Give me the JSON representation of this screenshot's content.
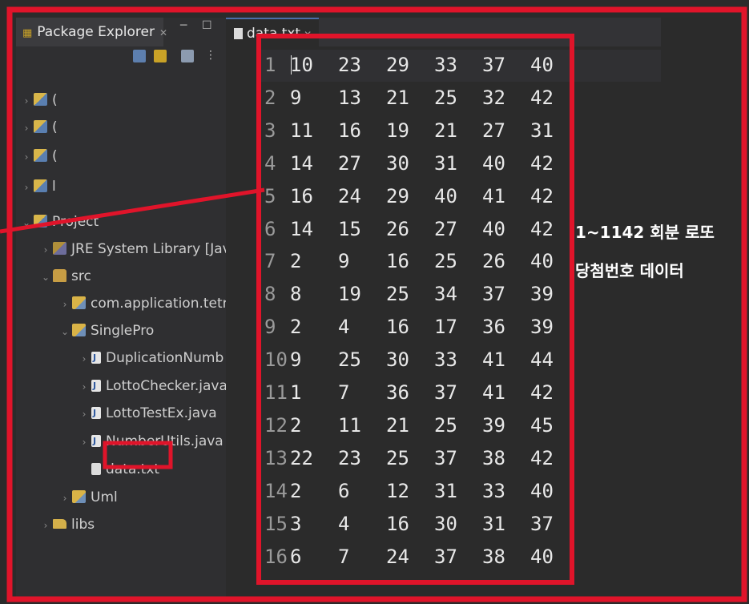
{
  "explorer": {
    "title": "Package Explorer",
    "tab_close": "✕",
    "minimize_glyph": "─",
    "maximize_glyph": "☐",
    "tree": [
      {
        "label": "(",
        "icon": "project-icon",
        "depth": 0,
        "arrow": "›"
      },
      {
        "label": "(",
        "icon": "project-icon",
        "depth": 0,
        "arrow": "›"
      },
      {
        "label": "(",
        "icon": "project-icon",
        "depth": 0,
        "arrow": "›"
      },
      {
        "label": "l",
        "icon": "project-icon",
        "depth": 0,
        "arrow": "›"
      },
      {
        "label": "Project",
        "icon": "project-icon",
        "depth": 0,
        "arrow": "⌄"
      },
      {
        "label": "JRE System Library [Java",
        "icon": "library-icon",
        "depth": 1,
        "arrow": "›"
      },
      {
        "label": "src",
        "icon": "source-folder-icon",
        "depth": 1,
        "arrow": "⌄"
      },
      {
        "label": "com.application.tetri",
        "icon": "package-icon",
        "depth": 2,
        "arrow": "›"
      },
      {
        "label": "SinglePro",
        "icon": "package-icon",
        "depth": 2,
        "arrow": "⌄"
      },
      {
        "label": "DuplicationNumb",
        "icon": "java-file-icon",
        "depth": 3,
        "arrow": "›"
      },
      {
        "label": "LottoChecker.java",
        "icon": "java-file-icon",
        "depth": 3,
        "arrow": "›"
      },
      {
        "label": "LottoTestEx.java",
        "icon": "java-file-icon",
        "depth": 3,
        "arrow": "›"
      },
      {
        "label": "NumberUtils.java",
        "icon": "java-file-icon",
        "depth": 3,
        "arrow": "›"
      },
      {
        "label": "data.txt",
        "icon": "text-file-icon",
        "depth": 3,
        "arrow": ""
      },
      {
        "label": "Uml",
        "icon": "package-icon",
        "depth": 2,
        "arrow": "›"
      },
      {
        "label": "libs",
        "icon": "folder-icon",
        "depth": 1,
        "arrow": "›"
      }
    ]
  },
  "editor": {
    "tab_label": "data.txt",
    "tab_close": "✕",
    "lines": [
      {
        "n": "1",
        "values": [
          "10",
          "23",
          "29",
          "33",
          "37",
          "40"
        ]
      },
      {
        "n": "2",
        "values": [
          "9",
          "13",
          "21",
          "25",
          "32",
          "42"
        ]
      },
      {
        "n": "3",
        "values": [
          "11",
          "16",
          "19",
          "21",
          "27",
          "31"
        ]
      },
      {
        "n": "4",
        "values": [
          "14",
          "27",
          "30",
          "31",
          "40",
          "42"
        ]
      },
      {
        "n": "5",
        "values": [
          "16",
          "24",
          "29",
          "40",
          "41",
          "42"
        ]
      },
      {
        "n": "6",
        "values": [
          "14",
          "15",
          "26",
          "27",
          "40",
          "42"
        ]
      },
      {
        "n": "7",
        "values": [
          "2",
          "9",
          "16",
          "25",
          "26",
          "40"
        ]
      },
      {
        "n": "8",
        "values": [
          "8",
          "19",
          "25",
          "34",
          "37",
          "39"
        ]
      },
      {
        "n": "9",
        "values": [
          "2",
          "4",
          "16",
          "17",
          "36",
          "39"
        ]
      },
      {
        "n": "10",
        "values": [
          "9",
          "25",
          "30",
          "33",
          "41",
          "44"
        ]
      },
      {
        "n": "11",
        "values": [
          "1",
          "7",
          "36",
          "37",
          "41",
          "42"
        ]
      },
      {
        "n": "12",
        "values": [
          "2",
          "11",
          "21",
          "25",
          "39",
          "45"
        ]
      },
      {
        "n": "13",
        "values": [
          "22",
          "23",
          "25",
          "37",
          "38",
          "42"
        ]
      },
      {
        "n": "14",
        "values": [
          "2",
          "6",
          "12",
          "31",
          "33",
          "40"
        ]
      },
      {
        "n": "15",
        "values": [
          "3",
          "4",
          "16",
          "30",
          "31",
          "37"
        ]
      },
      {
        "n": "16",
        "values": [
          "6",
          "7",
          "24",
          "37",
          "38",
          "40"
        ]
      }
    ]
  },
  "annotation": {
    "line1": "1~1142 회분 로또",
    "line2": "당첨번호 데이터"
  },
  "colors": {
    "highlight_box": "#e0142a",
    "background": "#2b2b2b",
    "panel": "#2f2f31"
  }
}
